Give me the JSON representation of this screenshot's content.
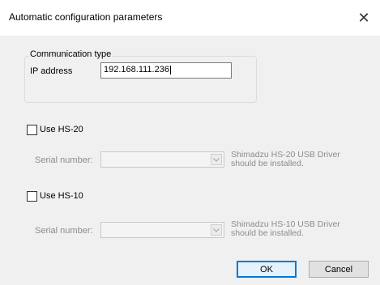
{
  "window": {
    "title": "Automatic configuration parameters",
    "close_symbol": "✕"
  },
  "communication": {
    "group_label": "Communication type",
    "ip_label": "IP address",
    "ip_value": "192.168.111.236"
  },
  "hs20": {
    "checkbox_label": "Use HS-20",
    "checked": false,
    "serial_label": "Serial number:",
    "serial_value": "",
    "note_line1": "Shimadzu HS-20 USB Driver",
    "note_line2": "should be installed."
  },
  "hs10": {
    "checkbox_label": "Use HS-10",
    "checked": false,
    "serial_label": "Serial number:",
    "serial_value": "",
    "note_line1": "Shimadzu HS-10 USB Driver",
    "note_line2": "should be installed."
  },
  "buttons": {
    "ok": "OK",
    "cancel": "Cancel"
  },
  "icons": {
    "dropdown": "chevron-down-icon",
    "close": "close-icon"
  }
}
